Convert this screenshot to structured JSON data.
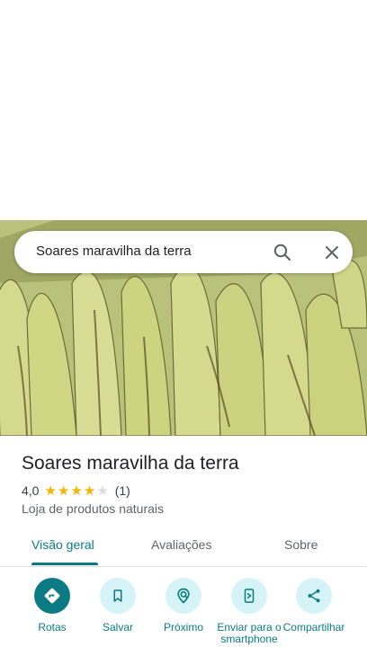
{
  "search": {
    "query": "Soares maravilha da terra"
  },
  "place": {
    "name": "Soares maravilha da terra",
    "rating": "4,0",
    "stars": 4,
    "stars_max": 5,
    "review_count": "(1)",
    "category": "Loja de produtos naturais"
  },
  "tabs": [
    {
      "label": "Visão geral",
      "active": true
    },
    {
      "label": "Avaliações",
      "active": false
    },
    {
      "label": "Sobre",
      "active": false
    }
  ],
  "actions": [
    {
      "label": "Rotas",
      "icon": "directions-icon"
    },
    {
      "label": "Salvar",
      "icon": "bookmark-icon"
    },
    {
      "label": "Próximo",
      "icon": "nearby-icon"
    },
    {
      "label": "Enviar para o smartphone",
      "icon": "send-to-phone-icon"
    },
    {
      "label": "Compartilhar",
      "icon": "share-icon"
    }
  ],
  "colors": {
    "accent": "#0b7b83",
    "accent_light": "#d6f3f8",
    "star": "#f4b400"
  }
}
